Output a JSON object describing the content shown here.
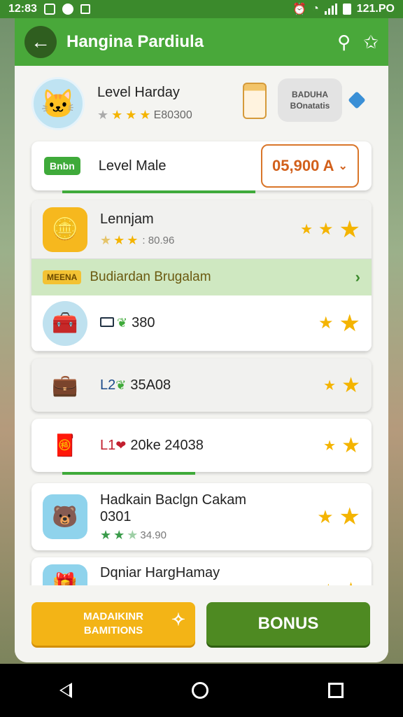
{
  "status_bar": {
    "time": "12:83",
    "battery_text": "121.PO"
  },
  "app_bar": {
    "title": "Hangina Pardiula"
  },
  "profile": {
    "name": "Level Harday",
    "rating_value": "E80300",
    "promo_line1": "BADUHA",
    "promo_line2": "BOnatatis"
  },
  "level_row": {
    "badge": "Bnbn",
    "label": "Level Male",
    "select_value": "05,900 A"
  },
  "list": {
    "item1": {
      "title": "Lennjam",
      "rating": " : 80.96"
    },
    "section": {
      "tag": "MEENA",
      "title": "Budiardan Brugalam"
    },
    "item2": {
      "value": "380"
    },
    "item3": {
      "prefix": "L2",
      "value": "35A08"
    },
    "item4": {
      "prefix": "L1",
      "value": "20ke 24038"
    }
  },
  "cards": {
    "card1": {
      "title_line1": "Hadkain Baclgn Cakam",
      "title_line2": "0301",
      "rating": "34.90"
    },
    "card2": {
      "title": "Dqniar HargHamay"
    }
  },
  "bottom": {
    "left_line1": "MADAIKINR",
    "left_line2": "BAMITIONS",
    "right": "BONUS"
  },
  "colors": {
    "primary_green": "#49a83a",
    "accent_orange": "#d9762a",
    "button_yellow": "#f3b416",
    "button_green": "#4e8a22"
  }
}
